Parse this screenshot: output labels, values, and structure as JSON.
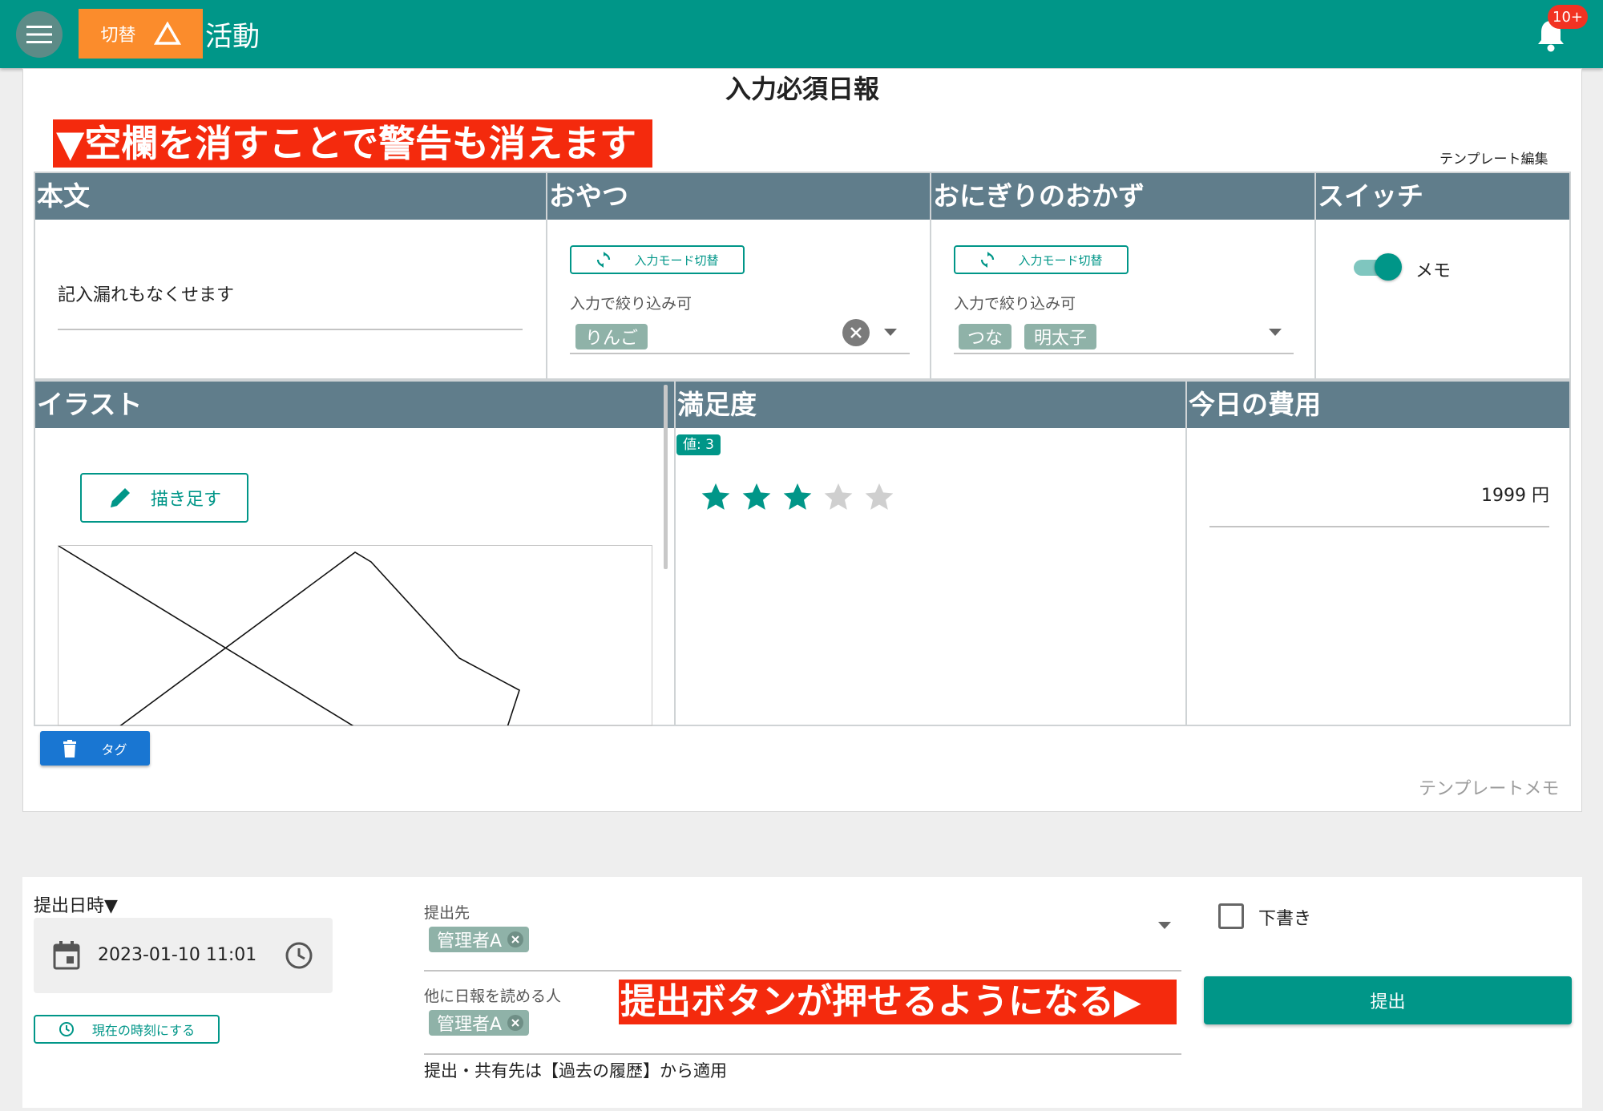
{
  "appbar": {
    "toggle_label": "切替",
    "title": "活動",
    "notification_badge": "10+"
  },
  "report": {
    "title": "入力必須日報",
    "warning_banner": "▼空欄を消すことで警告も消えます",
    "template_edit": "テンプレート編集",
    "template_memo": "テンプレートメモ",
    "tag_button": "タグ"
  },
  "fields": {
    "body": {
      "header": "本文",
      "value": "記入漏れもなくせます"
    },
    "snack": {
      "header": "おやつ",
      "mode_toggle": "入力モード切替",
      "filter_label": "入力で絞り込み可",
      "chips": [
        "りんご"
      ]
    },
    "onigiri": {
      "header": "おにぎりのおかず",
      "mode_toggle": "入力モード切替",
      "filter_label": "入力で絞り込み可",
      "chips": [
        "つな",
        "明太子"
      ]
    },
    "switch": {
      "header": "スイッチ",
      "label": "メモ",
      "on": true
    },
    "illust": {
      "header": "イラスト",
      "draw_button": "描き足す"
    },
    "satisfaction": {
      "header": "満足度",
      "value_label": "値: 3",
      "rating": 3,
      "max": 5
    },
    "cost": {
      "header": "今日の費用",
      "value": "1999 円"
    }
  },
  "submission": {
    "datetime_label": "提出日時▼",
    "datetime_value": "2023-01-10 11:01",
    "now_button": "現在の時刻にする",
    "recipient_label": "提出先",
    "recipient_chip": "管理者A",
    "readers_label": "他に日報を読める人",
    "readers_chip": "管理者A",
    "history_note": "提出・共有先は【過去の履歴】から適用",
    "submit_hint_banner": "提出ボタンが押せるようになる▶",
    "draft_label": "下書き",
    "submit_button": "提出"
  },
  "colors": {
    "primary": "#009688",
    "accent_orange": "#fb8c2c",
    "header_slate": "#607d8b",
    "banner_red": "#f42a0d",
    "tag_blue": "#1976d2"
  }
}
